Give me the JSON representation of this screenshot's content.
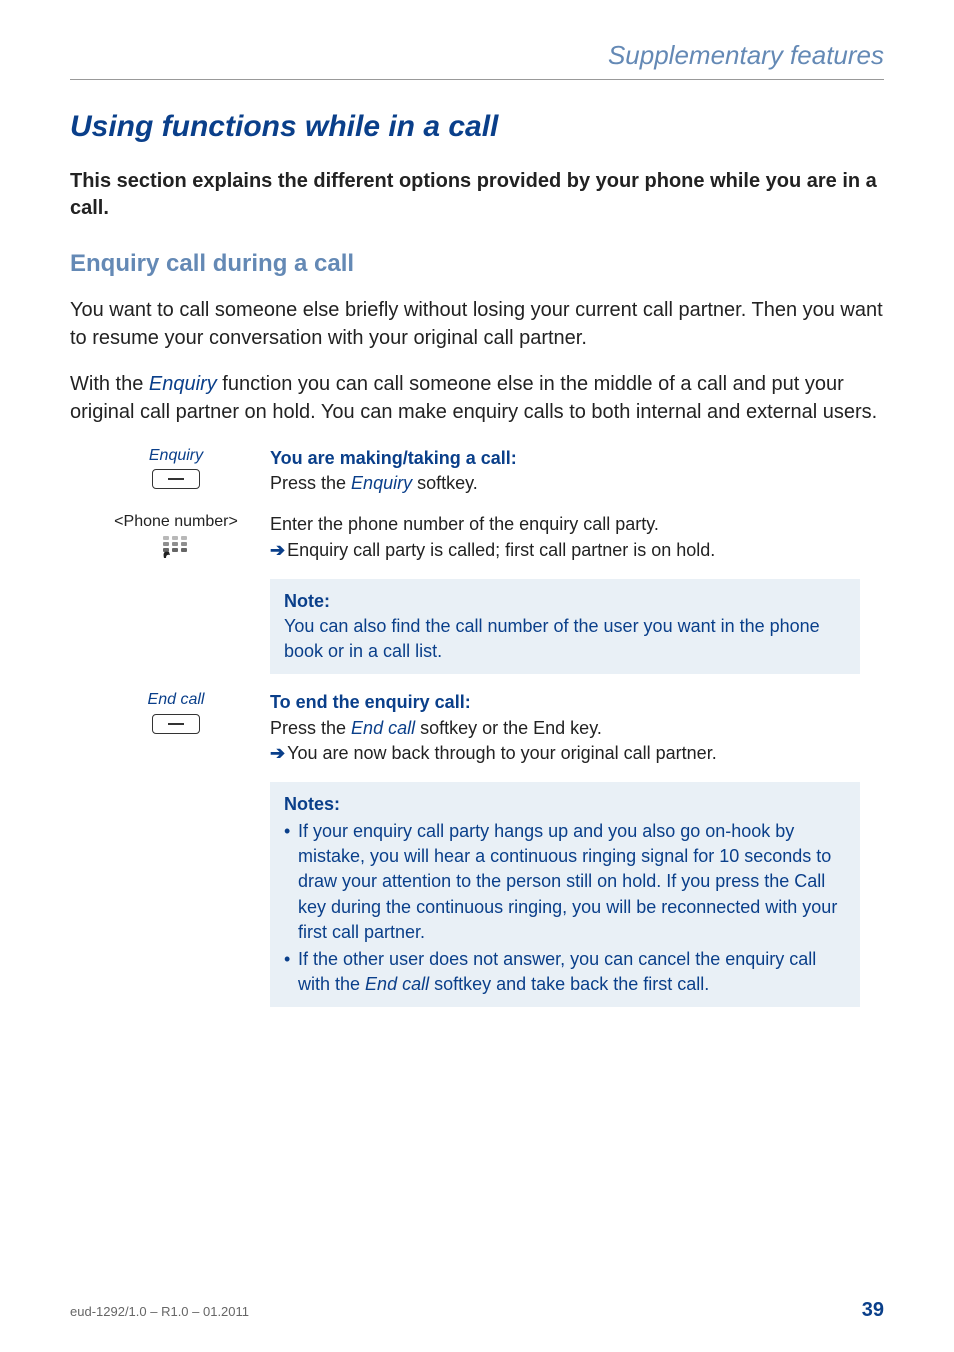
{
  "header": {
    "title": "Supplementary features"
  },
  "section": {
    "title": "Using functions while in a call"
  },
  "intro": "This section explains the different options provided by your phone while you are in a call.",
  "sub": {
    "title": "Enquiry call during a call"
  },
  "para1": "You want to call someone else briefly without losing your current call partner. Then you want to resume your conversation with your original call partner.",
  "para2_a": "With the ",
  "para2_term": "Enquiry",
  "para2_b": " function you can call someone else in the middle of a call and put your original call partner on hold. You can make enquiry calls to both internal and external users.",
  "steps": {
    "s1": {
      "left": "Enquiry",
      "title": "You are making/taking a call:",
      "line_a": "Press the ",
      "line_term": "Enquiry",
      "line_b": " softkey."
    },
    "s2": {
      "left": "<Phone number>",
      "line1": "Enter the phone number of the enquiry call party.",
      "line2": "Enquiry call party is called; first call partner is on hold."
    },
    "note1": {
      "label": "Note:",
      "text": "You can also find the call number of the user you want in the phone book or in a call list."
    },
    "s3": {
      "left": "End call",
      "title": "To end the enquiry call:",
      "line1_a": "Press the ",
      "line1_term": "End call",
      "line1_b": " softkey or the End key.",
      "line2": "You are now back through to your original call partner."
    },
    "note2": {
      "label": "Notes:",
      "li1": "If your enquiry call party hangs up and you also go on-hook by mistake, you will hear a continuous ringing signal for 10 seconds to draw your attention to the person still on hold. If you press the Call key during the continuous ringing, you will be reconnected with your first call partner.",
      "li2_a": "If the other user does not answer, you can cancel the enquiry call with the ",
      "li2_term": "End call",
      "li2_b": " softkey and take back the first call."
    }
  },
  "footer": {
    "doc_id": "eud-1292/1.0 – R1.0 – 01.2011",
    "page": "39"
  }
}
